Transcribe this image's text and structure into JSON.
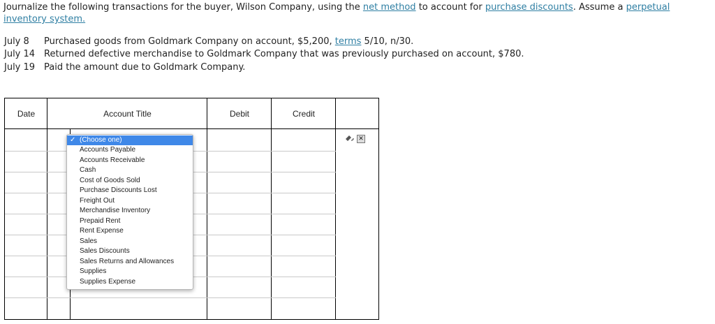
{
  "question": {
    "p1": "Journalize the following transactions for the buyer, Wilson Company, using the ",
    "link1": "net method",
    "p2": " to account for ",
    "link2": "purchase discounts",
    "p3": ". Assume a ",
    "link3": "perpetual inventory system."
  },
  "transactions": [
    {
      "date": "July  8",
      "text": "Purchased goods from Goldmark Company on account, $5,200, ",
      "link": "terms",
      "after": " 5/10, n/30."
    },
    {
      "date": "July 14",
      "text": "Returned defective merchandise to Goldmark Company that was previously purchased on account, $780.",
      "link": "",
      "after": ""
    },
    {
      "date": "July 19",
      "text": "Paid the amount due to Goldmark Company.",
      "link": "",
      "after": ""
    }
  ],
  "table": {
    "headers": {
      "date": "Date",
      "account": "Account Title",
      "debit": "Debit",
      "credit": "Credit"
    }
  },
  "dropdown": {
    "selected": "(Choose one)",
    "options": [
      "(Choose one)",
      "Accounts Payable",
      "Accounts Receivable",
      "Cash",
      "Cost of Goods Sold",
      "Purchase Discounts Lost",
      "Freight Out",
      "Merchandise Inventory",
      "Prepaid Rent",
      "Rent Expense",
      "Sales",
      "Sales Discounts",
      "Sales Returns and Allowances",
      "Supplies",
      "Supplies Expense"
    ]
  },
  "icons": {
    "edit": "undo-pencil-icon",
    "delete": "close-icon"
  },
  "colors": {
    "link": "#2f7fa3",
    "selected_option": "#3f88e8"
  }
}
